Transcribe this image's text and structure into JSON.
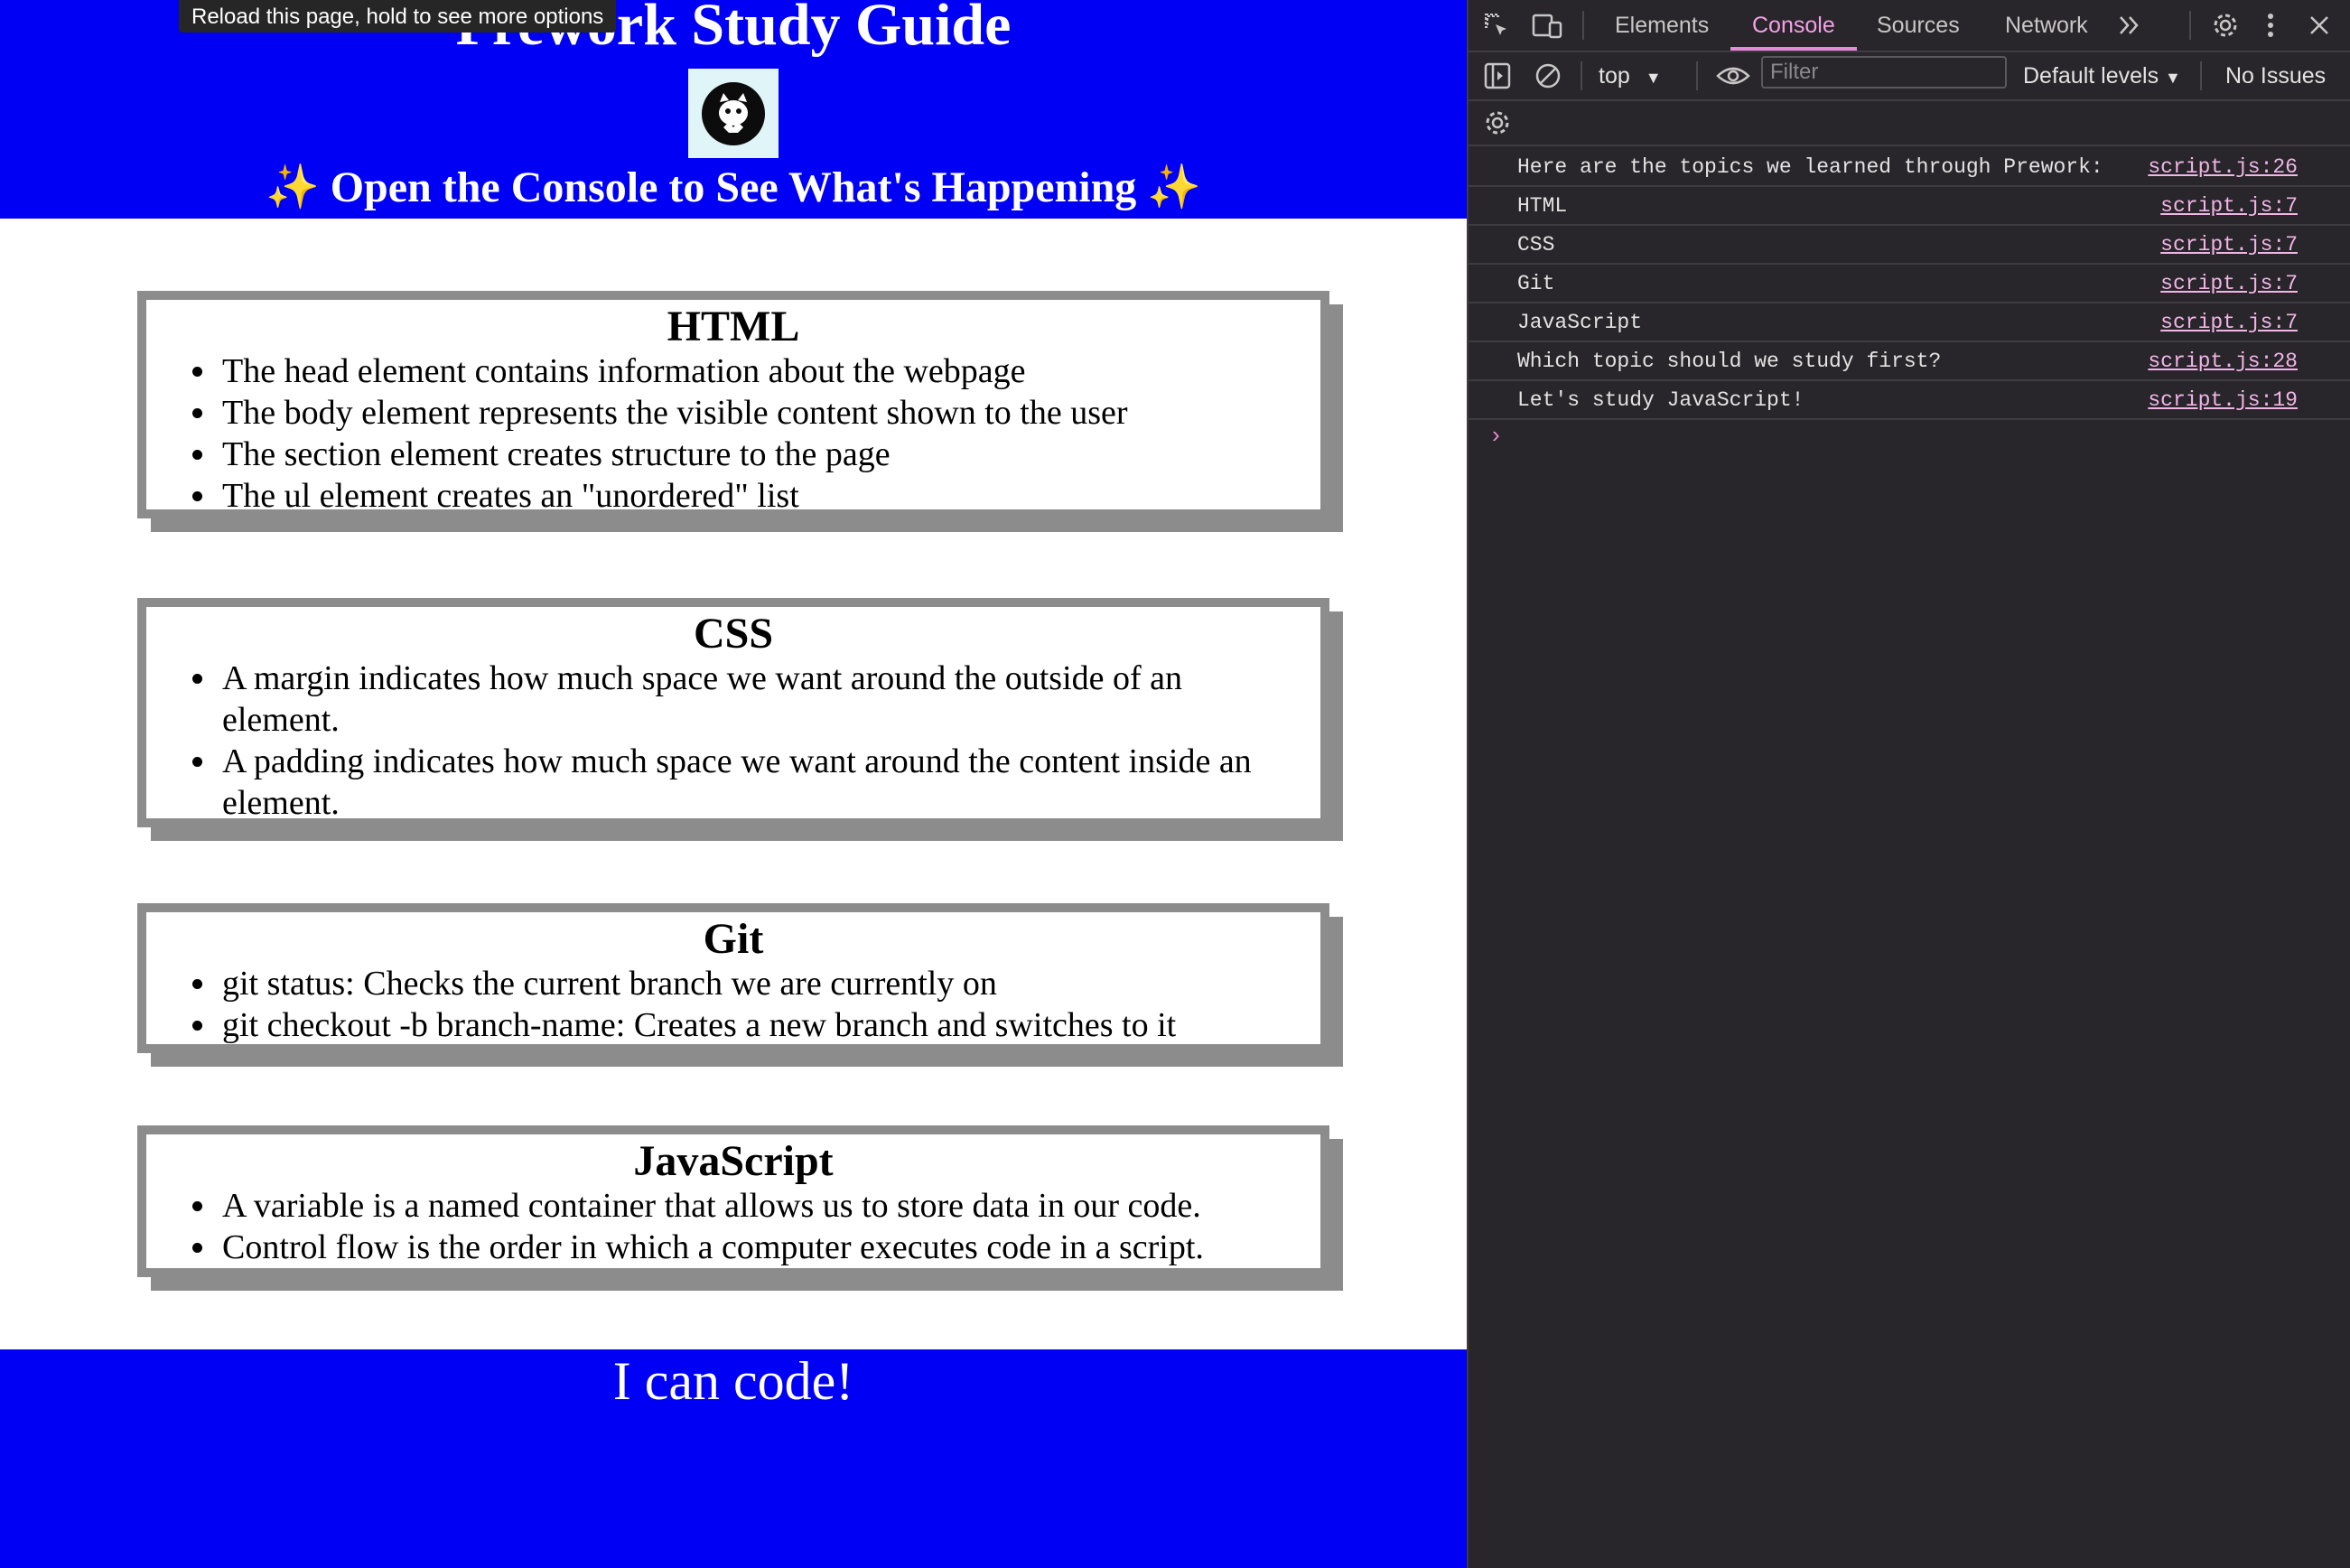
{
  "tooltip": "Reload this page, hold to see more options",
  "hero": {
    "title": "Prework Study Guide",
    "subtitle": "Open the Console to See What's Happening",
    "sparkle": "✨"
  },
  "sections": [
    {
      "heading": "HTML",
      "items": [
        "The head element contains information about the webpage",
        "The body element represents the visible content shown to the user",
        "The section element creates structure to the page",
        "The ul element creates an \"unordered\" list"
      ]
    },
    {
      "heading": "CSS",
      "items": [
        "A margin indicates how much space we want around the outside of an element.",
        "A padding indicates how much space we want around the content inside an element."
      ]
    },
    {
      "heading": "Git",
      "items": [
        "git status: Checks the current branch we are currently on",
        "git checkout -b branch-name: Creates a new branch and switches to it"
      ]
    },
    {
      "heading": "JavaScript",
      "items": [
        "A variable is a named container that allows us to store data in our code.",
        "Control flow is the order in which a computer executes code in a script."
      ]
    }
  ],
  "footer": {
    "text": "I can code!"
  },
  "devtools": {
    "tabs": [
      "Elements",
      "Console",
      "Sources",
      "Network"
    ],
    "active_tab": "Console",
    "context": "top",
    "filter_placeholder": "Filter",
    "levels": "Default levels",
    "issues": "No Issues",
    "console_lines": [
      {
        "message": "Here are the topics we learned through Prework:",
        "source": "script.js:26"
      },
      {
        "message": "HTML",
        "source": "script.js:7"
      },
      {
        "message": "CSS",
        "source": "script.js:7"
      },
      {
        "message": "Git",
        "source": "script.js:7"
      },
      {
        "message": "JavaScript",
        "source": "script.js:7"
      },
      {
        "message": "Which topic should we study first?",
        "source": "script.js:28"
      },
      {
        "message": "Let's study JavaScript!",
        "source": "script.js:19"
      }
    ],
    "prompt": "›"
  },
  "colors": {
    "hero_blue": "#0000f5",
    "card_border": "#8c8c8c",
    "devtools_bg": "#28262a",
    "accent_pink": "#e889d8"
  }
}
